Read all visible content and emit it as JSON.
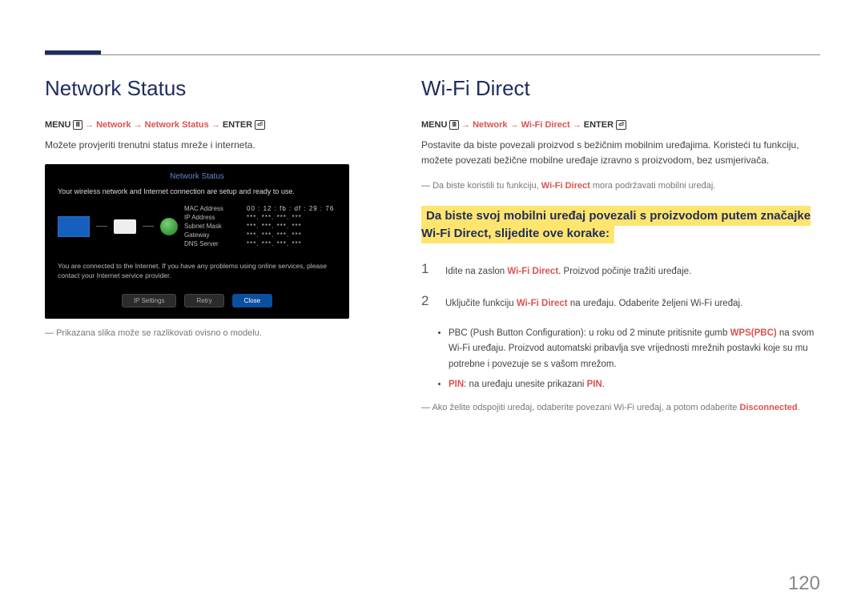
{
  "page_number": "120",
  "left": {
    "heading": "Network Status",
    "menu_prefix": "MENU",
    "menu_path_parts": [
      "Network",
      "Network Status"
    ],
    "menu_enter": "ENTER",
    "body": "Možete provjeriti trenutni status mreže i interneta.",
    "note": "Prikazana slika može se razlikovati ovisno o modelu.",
    "screenshot": {
      "title": "Network Status",
      "line1": "Your wireless network and Internet connection are setup and ready to use.",
      "info": {
        "mac_label": "MAC Address",
        "mac_value": "00 : 12 : fb : df : 29 : 76",
        "ip_label": "IP Address",
        "ip_value": "***. ***. ***. ***",
        "subnet_label": "Subnet Mask",
        "subnet_value": "***. ***. ***. ***",
        "gateway_label": "Gateway",
        "gateway_value": "***. ***. ***. ***",
        "dns_label": "DNS Server",
        "dns_value": "***. ***. ***. ***"
      },
      "line2": "You are connected to the Internet. If you have any problems using online services, please contact your Internet service provider.",
      "buttons": {
        "ip": "IP Settings",
        "retry": "Retry",
        "close": "Close"
      }
    }
  },
  "right": {
    "heading": "Wi-Fi Direct",
    "menu_prefix": "MENU",
    "menu_path_parts": [
      "Network",
      "Wi-Fi Direct"
    ],
    "menu_enter": "ENTER",
    "body": "Postavite da biste povezali proizvod s bežičnim mobilnim uređajima. Koristeći tu funkciju, možete povezati bežične mobilne uređaje izravno s proizvodom, bez usmjerivača.",
    "note1_pre": "Da biste koristili tu funkciju, ",
    "note1_hl": "Wi-Fi Direct",
    "note1_post": " mora podržavati mobilni uređaj.",
    "highlight": "Da biste svoj mobilni uređaj povezali s proizvodom putem značajke Wi-Fi Direct, slijedite ove korake:",
    "steps": [
      {
        "n": "1",
        "pre": "Idite na zaslon ",
        "hl": "Wi-Fi Direct",
        "post": ". Proizvod počinje tražiti uređaje."
      },
      {
        "n": "2",
        "pre": "Uključite funkciju ",
        "hl": "Wi-Fi Direct",
        "post": " na uređaju. Odaberite željeni Wi-Fi uređaj."
      }
    ],
    "bullets": [
      {
        "pre": "PBC (Push Button Configuration): u roku od 2 minute pritisnite gumb ",
        "hl": "WPS(PBC)",
        "post": " na svom Wi-Fi uređaju. Proizvod automatski pribavlja sve vrijednosti mrežnih postavki koje su mu potrebne i povezuje se s vašom mrežom."
      },
      {
        "pre_hl": "PIN",
        "mid": ": na uređaju unesite prikazani ",
        "hl": "PIN",
        "post": "."
      }
    ],
    "note2_pre": "Ako želite odspojiti uređaj, odaberite povezani Wi-Fi uređaj, a potom odaberite ",
    "note2_hl": "Disconnected",
    "note2_post": "."
  }
}
